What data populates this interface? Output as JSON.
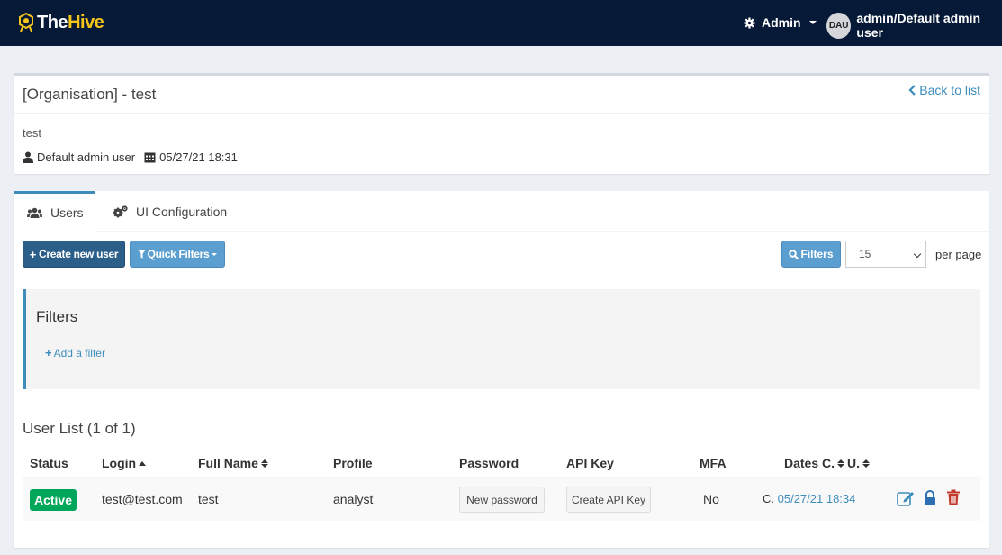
{
  "colors": {
    "navbar": "#061a38",
    "brand_yellow": "#f5c518",
    "primary_dark": "#2b5f8a",
    "primary_light": "#5b9fd1",
    "link": "#3c8dbc",
    "success": "#00a65a",
    "danger": "#c0392b"
  },
  "navbar": {
    "logo_the": "The",
    "logo_hive": "Hive",
    "admin_menu_label": "Admin",
    "user_initials": "DAU",
    "user_label": "admin/Default admin user"
  },
  "organisation": {
    "title": "[Organisation] - test",
    "back_link": "Back to list",
    "description": "test",
    "created_by": "Default admin user",
    "created_at": "05/27/21 18:31"
  },
  "tabs": [
    {
      "label": "Users",
      "icon": "users-icon",
      "active": true
    },
    {
      "label": "UI Configuration",
      "icon": "gears-icon",
      "active": false
    }
  ],
  "toolbar": {
    "create_user_label": "Create new user",
    "quick_filters_label": "Quick Filters",
    "filters_label": "Filters",
    "per_page_value": "15",
    "per_page_label": "per page"
  },
  "filters_panel": {
    "title": "Filters",
    "add_filter_label": "Add a filter"
  },
  "user_list": {
    "title": "User List (1 of 1)",
    "columns": {
      "status": "Status",
      "login": "Login",
      "full_name": "Full Name",
      "profile": "Profile",
      "password": "Password",
      "api_key": "API Key",
      "mfa": "MFA",
      "dates": "Dates C.",
      "dates_u": "U."
    },
    "rows": [
      {
        "status": "Active",
        "login": "test@test.com",
        "full_name": "test",
        "profile": "analyst",
        "password_button": "New password",
        "api_key_button": "Create API Key",
        "mfa": "No",
        "date_prefix": "C.",
        "date_created": "05/27/21 18:34"
      }
    ]
  }
}
